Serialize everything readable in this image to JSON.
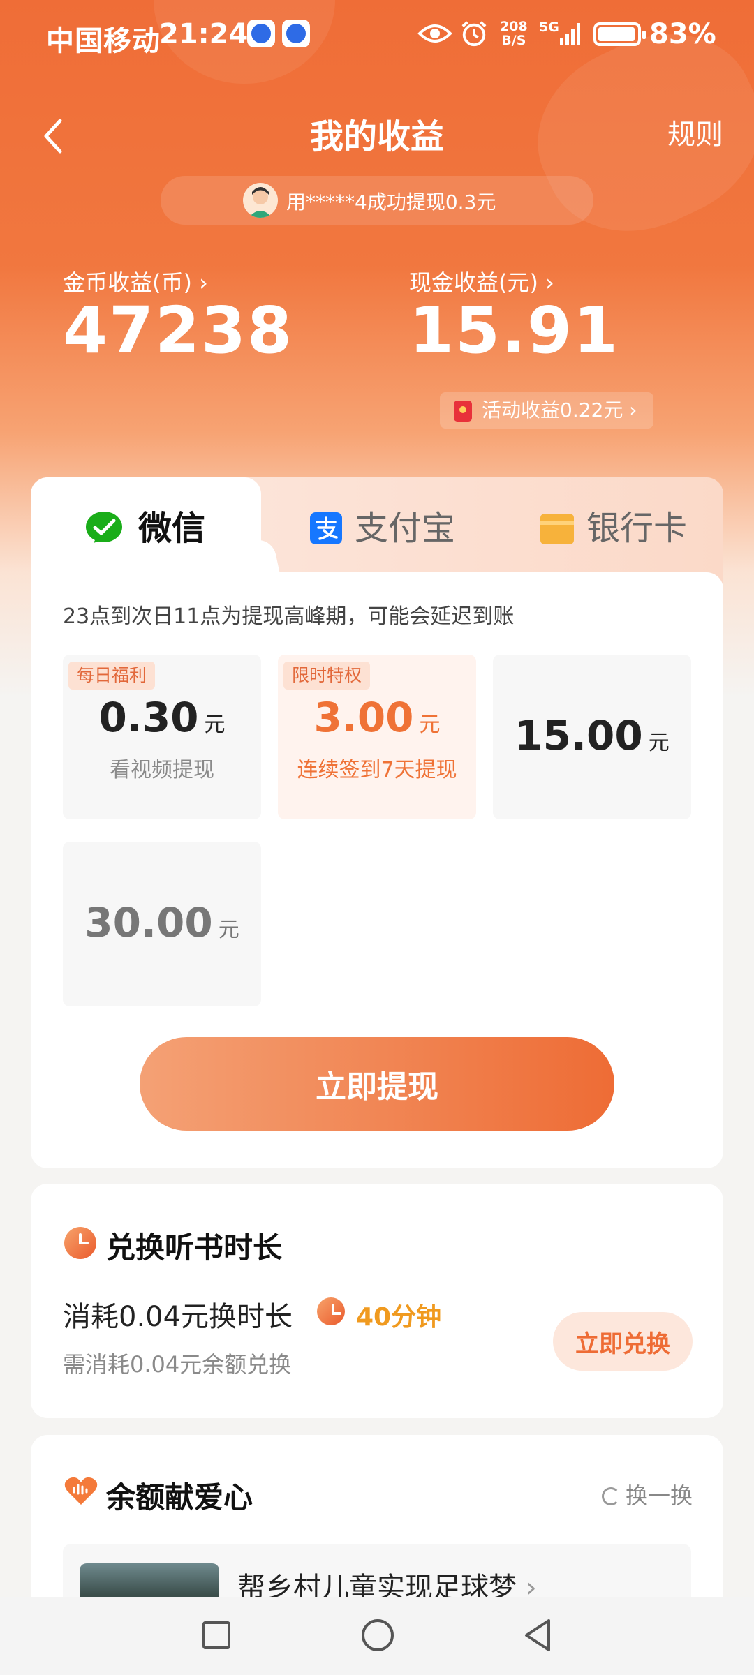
{
  "status_bar": {
    "carrier": "中国移动",
    "time": "21:24",
    "net_speed_top": "208",
    "net_speed_unit": "B/S",
    "network": "5G",
    "battery": "83%"
  },
  "header": {
    "title": "我的收益",
    "rules": "规则"
  },
  "ticker": {
    "text": "用*****4成功提现0.3元"
  },
  "earnings": {
    "coin_label": "金币收益(币)",
    "coin_value": "47238",
    "cash_label": "现金收益(元)",
    "cash_value": "15.91",
    "activity": "活动收益0.22元"
  },
  "withdraw": {
    "tabs": [
      {
        "label": "微信",
        "icon": "wechat-icon",
        "color": "#1aad19"
      },
      {
        "label": "支付宝",
        "icon": "alipay-icon",
        "color": "#1677ff"
      },
      {
        "label": "银行卡",
        "icon": "bank-card-icon",
        "color": "#f7b23b"
      }
    ],
    "selected_tab": "微信",
    "notice": "23点到次日11点为提现高峰期，可能会延迟到账",
    "options": [
      {
        "badge": "每日福利",
        "amount": "0.30",
        "unit": "元",
        "sub": "看视频提现"
      },
      {
        "badge": "限时特权",
        "amount": "3.00",
        "unit": "元",
        "sub": "连续签到7天提现"
      },
      {
        "amount": "15.00",
        "unit": "元"
      },
      {
        "amount": "30.00",
        "unit": "元"
      }
    ],
    "button": "立即提现"
  },
  "exchange": {
    "title": "兑换听书时长",
    "line": "消耗0.04元换时长",
    "minutes": "40分钟",
    "sub": "需消耗0.04元余额兑换",
    "button": "立即兑换"
  },
  "charity": {
    "title": "余额献爱心",
    "refresh": "换一换",
    "project_title": "帮乡村儿童实现足球梦"
  },
  "colors": {
    "brand": "#ee6c35",
    "accent_gold": "#f09a1f"
  }
}
